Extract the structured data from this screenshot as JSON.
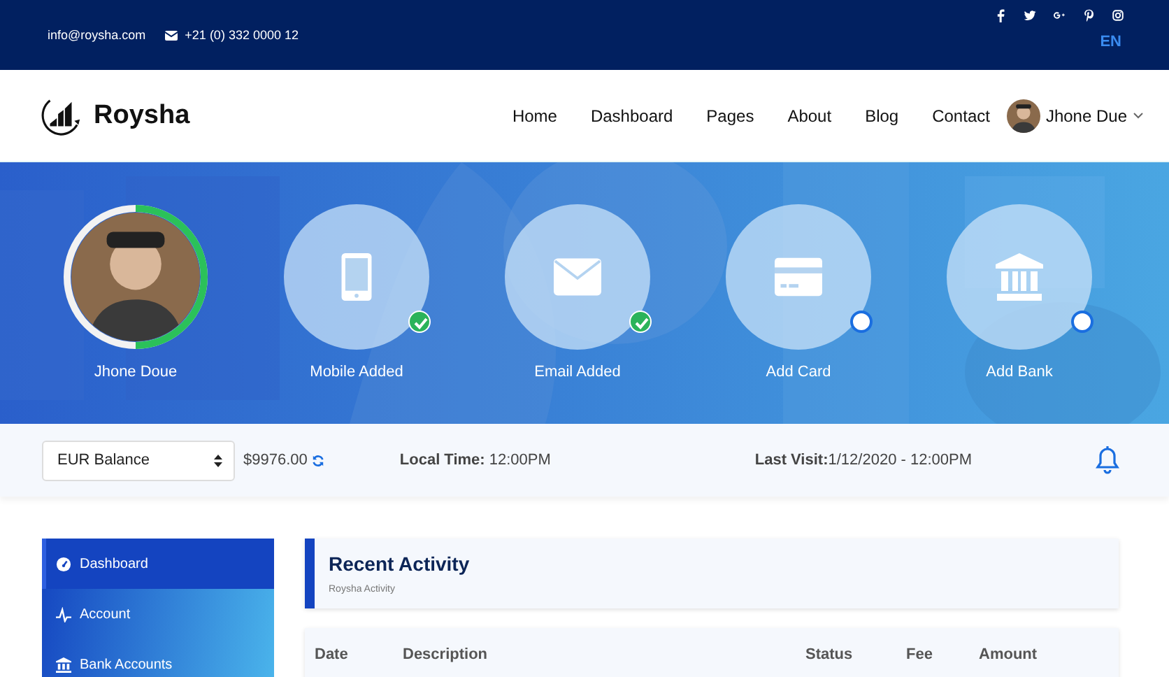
{
  "topbar": {
    "email": "info@roysha.com",
    "phone": "+21 (0) 332 0000 12",
    "social": [
      {
        "kind": "facebook"
      },
      {
        "kind": "twitter"
      },
      {
        "kind": "google-plus"
      },
      {
        "kind": "pinterest"
      },
      {
        "kind": "instagram"
      }
    ],
    "language": "EN"
  },
  "brand": "Roysha",
  "nav": [
    {
      "label": "Home"
    },
    {
      "label": "Dashboard"
    },
    {
      "label": "Pages"
    },
    {
      "label": "About"
    },
    {
      "label": "Blog"
    },
    {
      "label": "Contact"
    }
  ],
  "user": {
    "name": "Jhone Due"
  },
  "steps": [
    {
      "kind": "profile",
      "label": "Jhone Doue",
      "level": 0.5
    },
    {
      "kind": "mobile",
      "label": "Mobile Added",
      "done": true
    },
    {
      "kind": "email",
      "label": "Email Added",
      "done": true
    },
    {
      "kind": "card",
      "label": "Add Card",
      "done": false
    },
    {
      "kind": "bank",
      "label": "Add Bank",
      "done": false
    }
  ],
  "balance": {
    "select": "EUR Balance",
    "amount": "$9976.00",
    "local_time_label": "Local Time:",
    "local_time": "12:00PM",
    "last_visit_label": "Last Visit:",
    "last_visit": "1/12/2020 - 12:00PM"
  },
  "sidebar": {
    "items": [
      {
        "kind": "dashboard",
        "label": "Dashboard",
        "selected": true
      },
      {
        "kind": "account",
        "label": "Account",
        "selected": false
      },
      {
        "kind": "bank",
        "label": "Bank Accounts",
        "selected": false
      }
    ]
  },
  "activity": {
    "title": "Recent Activity",
    "subtitle": "Roysha Activity"
  },
  "table": {
    "columns": [
      "Date",
      "Description",
      "Status",
      "Fee",
      "Amount"
    ]
  }
}
